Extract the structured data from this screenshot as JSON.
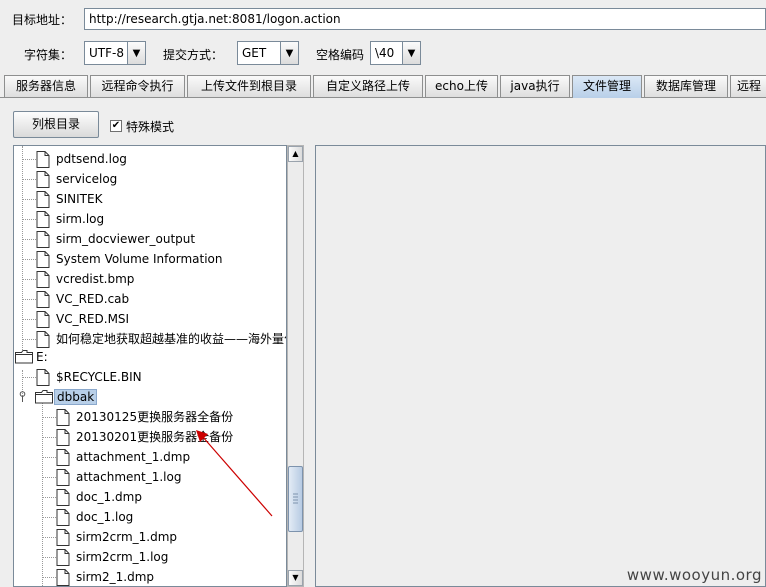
{
  "toolbar": {
    "url_label": "目标地址：",
    "url_value": "http://research.gtja.net:8081/logon.action",
    "charset_label": "字符集：",
    "charset_value": "UTF-8",
    "method_label": "提交方式：",
    "method_value": "GET",
    "space_label": "空格编码",
    "space_value": "\\40"
  },
  "tabs": [
    {
      "label": "服务器信息"
    },
    {
      "label": "远程命令执行"
    },
    {
      "label": "上传文件到根目录"
    },
    {
      "label": "自定义路径上传"
    },
    {
      "label": "echo上传"
    },
    {
      "label": "java执行"
    },
    {
      "label": "文件管理",
      "active": true
    },
    {
      "label": "数据库管理"
    },
    {
      "label": "远程"
    }
  ],
  "controls": {
    "list_root_label": "列根目录",
    "special_mode_label": "特殊模式",
    "special_mode_checked": true
  },
  "tree": [
    {
      "label": "pdtsend.log",
      "type": "file",
      "depth": 1
    },
    {
      "label": "servicelog",
      "type": "file",
      "depth": 1
    },
    {
      "label": "SINITEK",
      "type": "file",
      "depth": 1
    },
    {
      "label": "sirm.log",
      "type": "file",
      "depth": 1
    },
    {
      "label": "sirm_docviewer_output",
      "type": "file",
      "depth": 1
    },
    {
      "label": "System Volume Information",
      "type": "file",
      "depth": 1
    },
    {
      "label": "vcredist.bmp",
      "type": "file",
      "depth": 1
    },
    {
      "label": "VC_RED.cab",
      "type": "file",
      "depth": 1
    },
    {
      "label": "VC_RED.MSI",
      "type": "file",
      "depth": 1
    },
    {
      "label": "如何稳定地获取超越基准的收益——海外量化",
      "type": "file",
      "depth": 1
    },
    {
      "label": "E:",
      "type": "folder",
      "depth": 0
    },
    {
      "label": "$RECYCLE.BIN",
      "type": "file",
      "depth": 1
    },
    {
      "label": "dbbak",
      "type": "folder",
      "depth": 1,
      "selected": true,
      "expanded": true
    },
    {
      "label": "20130125更换服务器全备份",
      "type": "file",
      "depth": 2
    },
    {
      "label": "20130201更换服务器全备份",
      "type": "file",
      "depth": 2
    },
    {
      "label": "attachment_1.dmp",
      "type": "file",
      "depth": 2
    },
    {
      "label": "attachment_1.log",
      "type": "file",
      "depth": 2
    },
    {
      "label": "doc_1.dmp",
      "type": "file",
      "depth": 2
    },
    {
      "label": "doc_1.log",
      "type": "file",
      "depth": 2
    },
    {
      "label": "sirm2crm_1.dmp",
      "type": "file",
      "depth": 2
    },
    {
      "label": "sirm2crm_1.log",
      "type": "file",
      "depth": 2
    },
    {
      "label": "sirm2_1.dmp",
      "type": "file",
      "depth": 2
    }
  ],
  "watermark": "www.wooyun.org",
  "colors": {
    "selection": "#b8cfe8",
    "annotation_arrow": "#cc0000",
    "active_tab": "#c6d9ee"
  }
}
